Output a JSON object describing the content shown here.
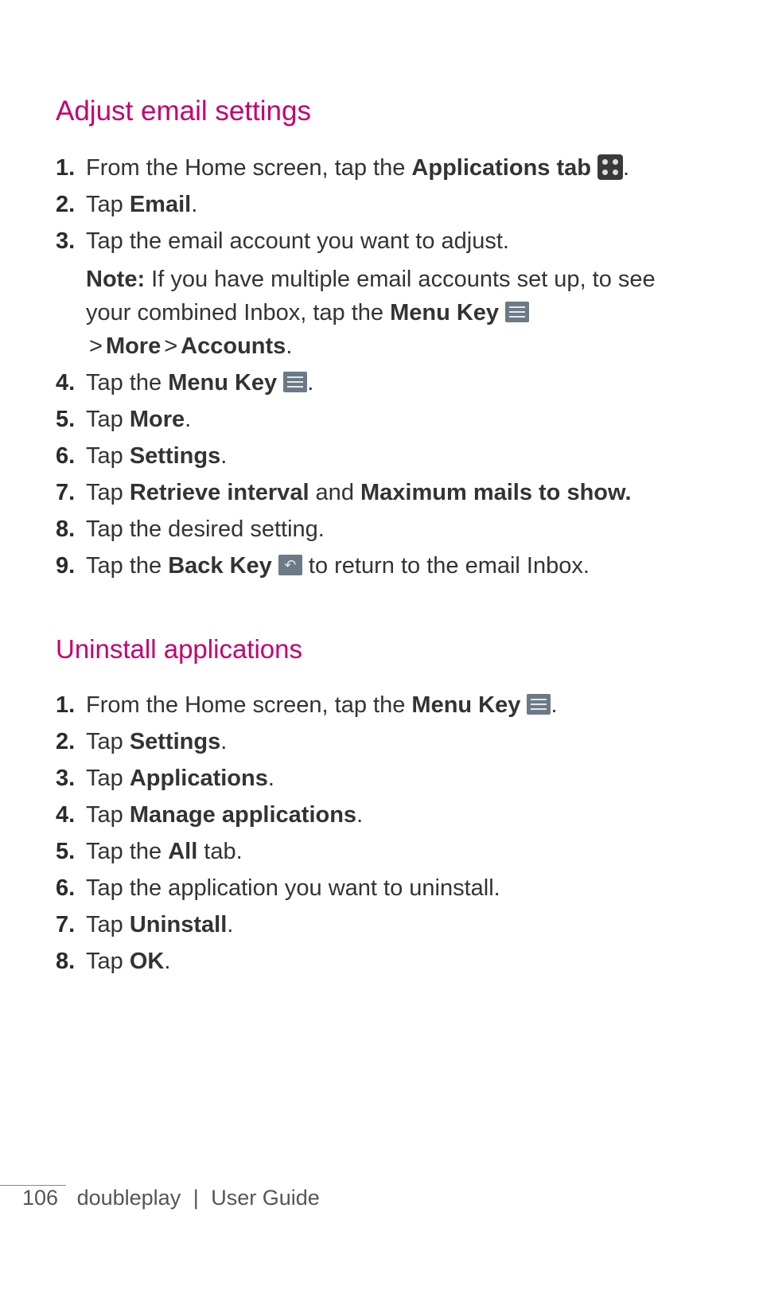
{
  "section1": {
    "heading": "Adjust email settings",
    "steps": [
      {
        "num": "1.",
        "pre": "From the Home screen, tap the ",
        "b1": "Applications tab ",
        "icon": "apps",
        "post": "."
      },
      {
        "num": "2.",
        "pre": "Tap ",
        "b1": "Email",
        "post": "."
      },
      {
        "num": "3.",
        "pre": "Tap the email account you want to adjust."
      },
      {
        "num": "4.",
        "pre": "Tap the ",
        "b1": "Menu Key ",
        "icon": "menu",
        "post": "."
      },
      {
        "num": "5.",
        "pre": "Tap ",
        "b1": "More",
        "post": "."
      },
      {
        "num": "6.",
        "pre": "Tap ",
        "b1": "Settings",
        "post": "."
      },
      {
        "num": "7.",
        "pre": "Tap ",
        "b1": "Retrieve interval",
        "mid": " and ",
        "b2": "Maximum mails to show."
      },
      {
        "num": "8.",
        "pre": "Tap the desired setting."
      },
      {
        "num": "9.",
        "pre": "Tap the ",
        "b1": "Back Key ",
        "icon": "back",
        "post": " to return to the email Inbox."
      }
    ],
    "note": {
      "label": "Note:",
      "text1": " If you have multiple email accounts set up, to see your combined Inbox, tap the ",
      "b1": "Menu Key ",
      "gt1": ">",
      "b2": "More",
      "gt2": ">",
      "b3": "Accounts",
      "end": "."
    }
  },
  "section2": {
    "heading": "Uninstall applications",
    "steps": [
      {
        "num": "1.",
        "pre": "From the Home screen, tap the ",
        "b1": "Menu Key ",
        "icon": "menu",
        "post": "."
      },
      {
        "num": "2.",
        "pre": "Tap ",
        "b1": "Settings",
        "post": "."
      },
      {
        "num": "3.",
        "pre": "Tap ",
        "b1": "Applications",
        "post": "."
      },
      {
        "num": "4.",
        "pre": "Tap ",
        "b1": "Manage applications",
        "post": "."
      },
      {
        "num": "5.",
        "pre": "Tap the ",
        "b1": "All",
        "post": " tab."
      },
      {
        "num": "6.",
        "pre": "Tap the application you want to uninstall."
      },
      {
        "num": "7.",
        "pre": "Tap ",
        "b1": "Uninstall",
        "post": "."
      },
      {
        "num": "8.",
        "pre": "Tap ",
        "b1": "OK",
        "post": "."
      }
    ]
  },
  "footer": {
    "page": "106",
    "product": "doubleplay",
    "sep": "|",
    "title": "User Guide"
  }
}
